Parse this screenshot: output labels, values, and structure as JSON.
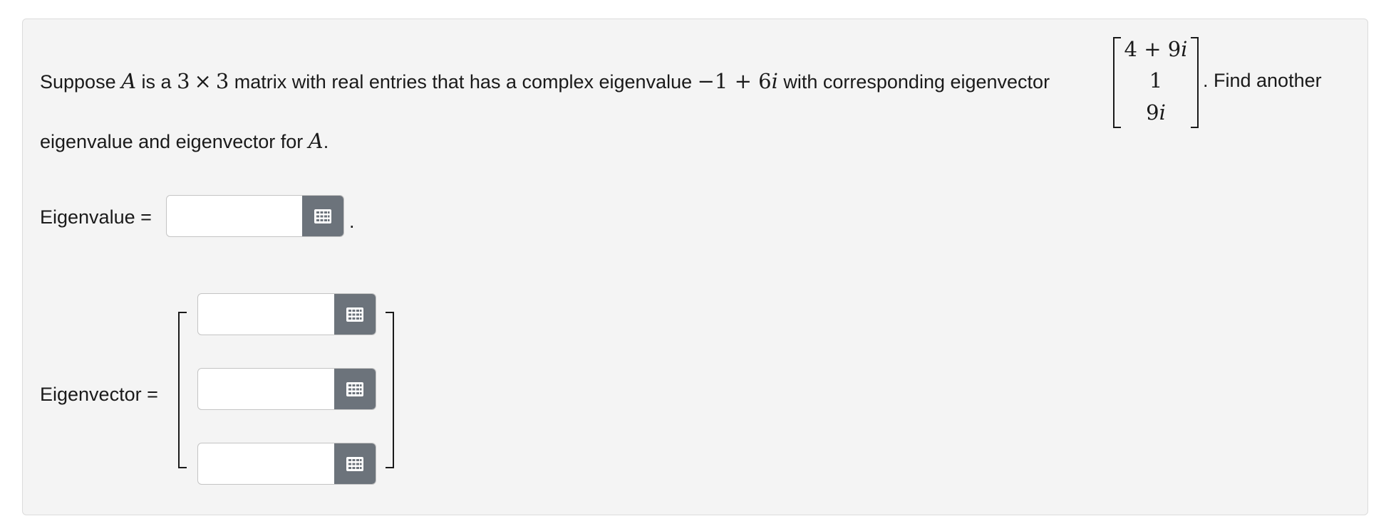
{
  "question": {
    "text_1": "Suppose ",
    "var_A": "A",
    "text_2": " is a ",
    "dim_3a": "3",
    "times": "×",
    "dim_3b": "3",
    "text_3": " matrix with real entries that has a complex eigenvalue ",
    "eig_minus": "−1",
    "eig_plus": " + 6",
    "eig_i": "i",
    "text_4": " with corresponding eigenvector",
    "vector": [
      "4 + 9",
      "1",
      "9"
    ],
    "vector_i": [
      "i",
      "",
      "i"
    ],
    "text_5": ". Find another",
    "text_6": "eigenvalue and eigenvector for ",
    "var_A2": "A",
    "period": "."
  },
  "eigenvalue": {
    "label": "Eigenvalue =",
    "value": "",
    "trailing": "."
  },
  "eigenvector": {
    "label": "Eigenvector =",
    "values": [
      "",
      "",
      ""
    ]
  },
  "icons": {
    "keyboard_button": "grid-keyboard-icon",
    "button_color": "#6c737b"
  }
}
